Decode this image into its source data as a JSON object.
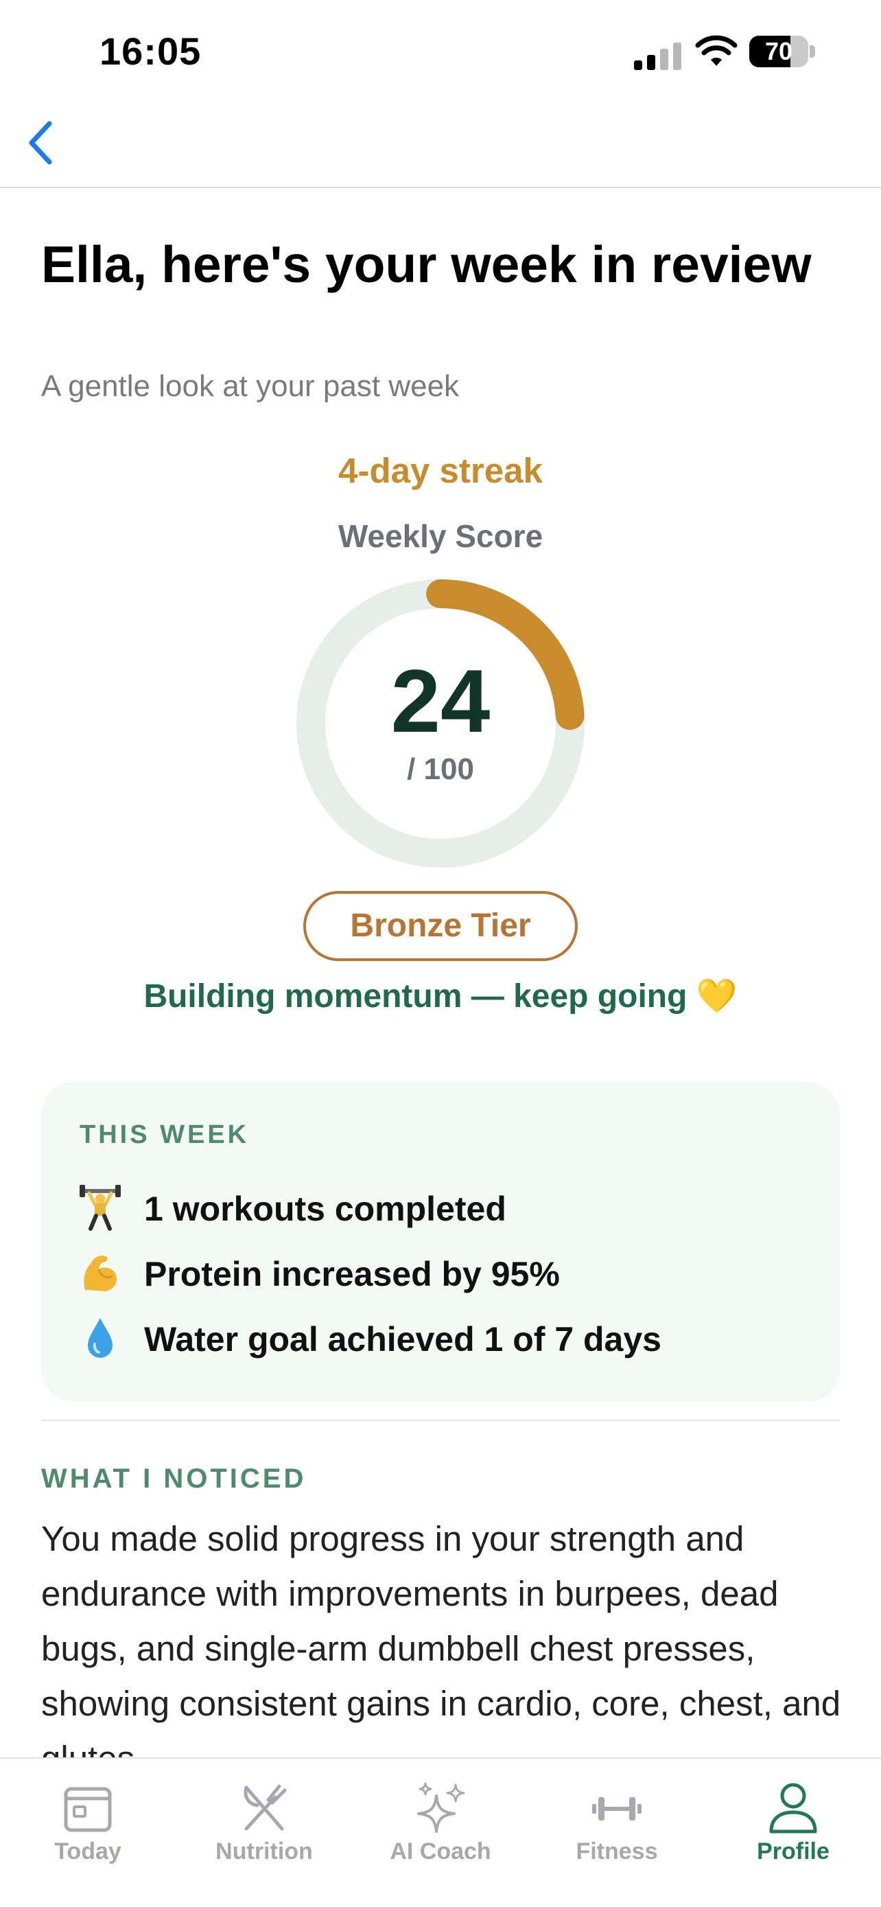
{
  "status_bar": {
    "time": "16:05",
    "battery_level": "70",
    "battery_fraction": 0.7
  },
  "nav": {
    "back_icon": "chevron-left-icon"
  },
  "header": {
    "title": "Ella, here's your week in review",
    "subtitle": "A gentle look at your past week"
  },
  "score": {
    "streak": "4-day streak",
    "label": "Weekly Score",
    "value": "24",
    "max": "/ 100",
    "fraction": 0.24,
    "tier": "Bronze Tier",
    "message": "Building momentum — keep going 💛"
  },
  "this_week": {
    "heading": "THIS WEEK",
    "items": [
      {
        "icon": "weightlifter-emoji",
        "text": "1 workouts completed"
      },
      {
        "icon": "flexed-biceps-emoji",
        "text": "Protein increased by 95%"
      },
      {
        "icon": "droplet-emoji",
        "text": "Water goal achieved 1 of 7 days"
      }
    ]
  },
  "noticed": {
    "heading": "WHAT I NOTICED",
    "text": "You made solid progress in your strength and endurance with improvements in burpees, dead bugs, and single-arm dumbbell chest presses, showing consistent gains in cardio, core, chest, and glutes."
  },
  "tabs": [
    {
      "label": "Today",
      "icon": "calendar-icon",
      "active": false
    },
    {
      "label": "Nutrition",
      "icon": "fork-knife-icon",
      "active": false
    },
    {
      "label": "AI Coach",
      "icon": "sparkles-icon",
      "active": false
    },
    {
      "label": "Fitness",
      "icon": "dumbbell-icon",
      "active": false
    },
    {
      "label": "Profile",
      "icon": "person-icon",
      "active": true
    }
  ],
  "colors": {
    "accent_gold": "#c98c2c",
    "bronze": "#b87431",
    "green": "#1f6a4a",
    "ring_track": "#e6eee9",
    "tab_active": "#1f7a55",
    "tab_inactive": "#a6a8ad",
    "ios_blue": "#1a7cf2"
  }
}
